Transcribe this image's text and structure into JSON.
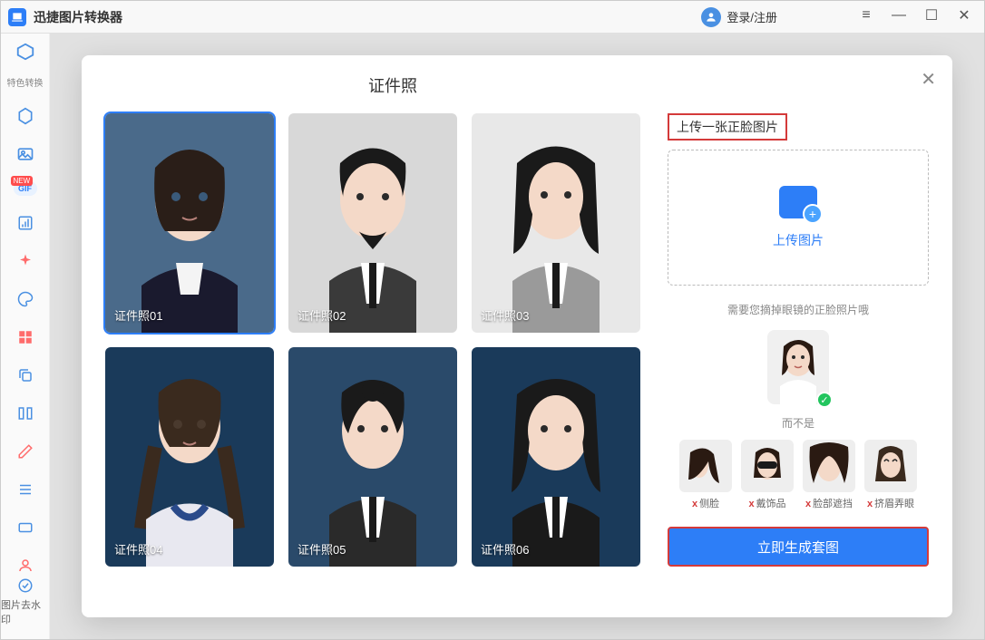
{
  "titlebar": {
    "app_name": "迅捷图片转换器",
    "login_text": "登录/注册"
  },
  "sidebar": {
    "top_label": "特色转换",
    "new_badge": "NEW",
    "gif_label": "GIF",
    "bottom_label": "图片去水印"
  },
  "modal": {
    "title": "证件照",
    "upload_label": "上传一张正脸图片",
    "upload_text": "上传图片",
    "hint": "需要您摘掉眼镜的正脸照片哦",
    "not_label": "而不是",
    "generate_btn": "立即生成套图",
    "templates": [
      {
        "label": "证件照01"
      },
      {
        "label": "证件照02"
      },
      {
        "label": "证件照03"
      },
      {
        "label": "证件照04"
      },
      {
        "label": "证件照05"
      },
      {
        "label": "证件照06"
      }
    ],
    "bad_examples": [
      {
        "label": "侧脸"
      },
      {
        "label": "戴饰品"
      },
      {
        "label": "脸部遮挡"
      },
      {
        "label": "挤眉弄眼"
      }
    ]
  }
}
